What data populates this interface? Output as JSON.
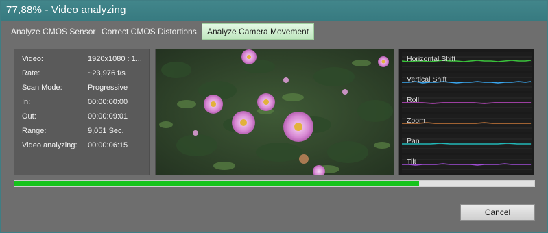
{
  "window": {
    "title": "77,88% - Video analyzing"
  },
  "tabs": [
    {
      "label": "Analyze CMOS Sensor",
      "active": false
    },
    {
      "label": "Correct CMOS Distortions",
      "active": false
    },
    {
      "label": "Analyze Camera Movement",
      "active": true
    }
  ],
  "info": [
    {
      "key": "Video:",
      "value": "1920x1080  : 1..."
    },
    {
      "key": "Rate:",
      "value": "~23,976 f/s"
    },
    {
      "key": "Scan Mode:",
      "value": "Progressive"
    },
    {
      "key": "In:",
      "value": "00:00:00:00"
    },
    {
      "key": "Out:",
      "value": "00:00:09:01"
    },
    {
      "key": "Range:",
      "value": "9,051 Sec."
    },
    {
      "key": "Video analyzing:",
      "value": "00:00:06:15"
    }
  ],
  "graphs": [
    {
      "label": "Horizontal Shift",
      "color": "#39c23a"
    },
    {
      "label": "Vertical Shift",
      "color": "#3aa8f2"
    },
    {
      "label": "Roll",
      "color": "#c64acb"
    },
    {
      "label": "Zoom",
      "color": "#cc7a3a"
    },
    {
      "label": "Pan",
      "color": "#21b8b8"
    },
    {
      "label": "Tilt",
      "color": "#a24dd8"
    }
  ],
  "progress": {
    "percent": 77.88
  },
  "buttons": {
    "cancel": "Cancel"
  },
  "colors": {
    "titlebar": "#3d8186",
    "progress": "#16c31c",
    "active_tab": "#c8eec8"
  }
}
